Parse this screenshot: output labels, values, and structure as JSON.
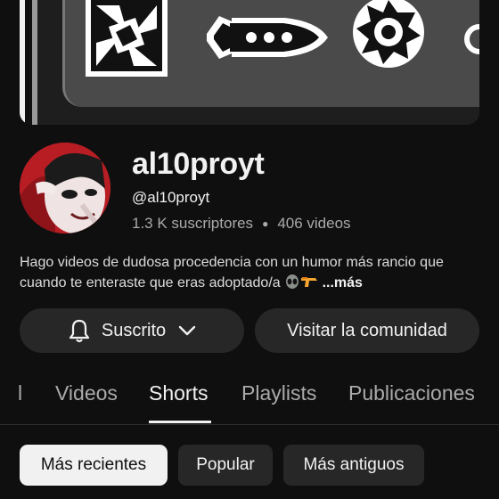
{
  "channel": {
    "name": "al10proyt",
    "handle": "@al10proyt",
    "subscribers": "1.3 K suscriptores",
    "videos": "406 videos",
    "description": "Hago videos de dudosa procedencia con un humor más rancio que cuando te enteraste que eras adoptado/a",
    "description_emojis": [
      "alien-icon",
      "water-gun-icon"
    ],
    "more_label": "...más"
  },
  "buttons": {
    "subscribed_label": "Suscrito",
    "community_label": "Visitar la comunidad"
  },
  "tabs": [
    {
      "label": "l",
      "active": false
    },
    {
      "label": "Videos",
      "active": false
    },
    {
      "label": "Shorts",
      "active": true
    },
    {
      "label": "Playlists",
      "active": false
    },
    {
      "label": "Publicaciones",
      "active": false
    }
  ],
  "chips": [
    {
      "label": "Más recientes",
      "selected": true
    },
    {
      "label": "Popular",
      "selected": false
    },
    {
      "label": "Más antiguos",
      "selected": false
    }
  ],
  "colors": {
    "background": "#0f0f0f",
    "button_bg": "#272727",
    "text_primary": "#f1f1f1",
    "text_secondary": "#aaaaaa"
  }
}
